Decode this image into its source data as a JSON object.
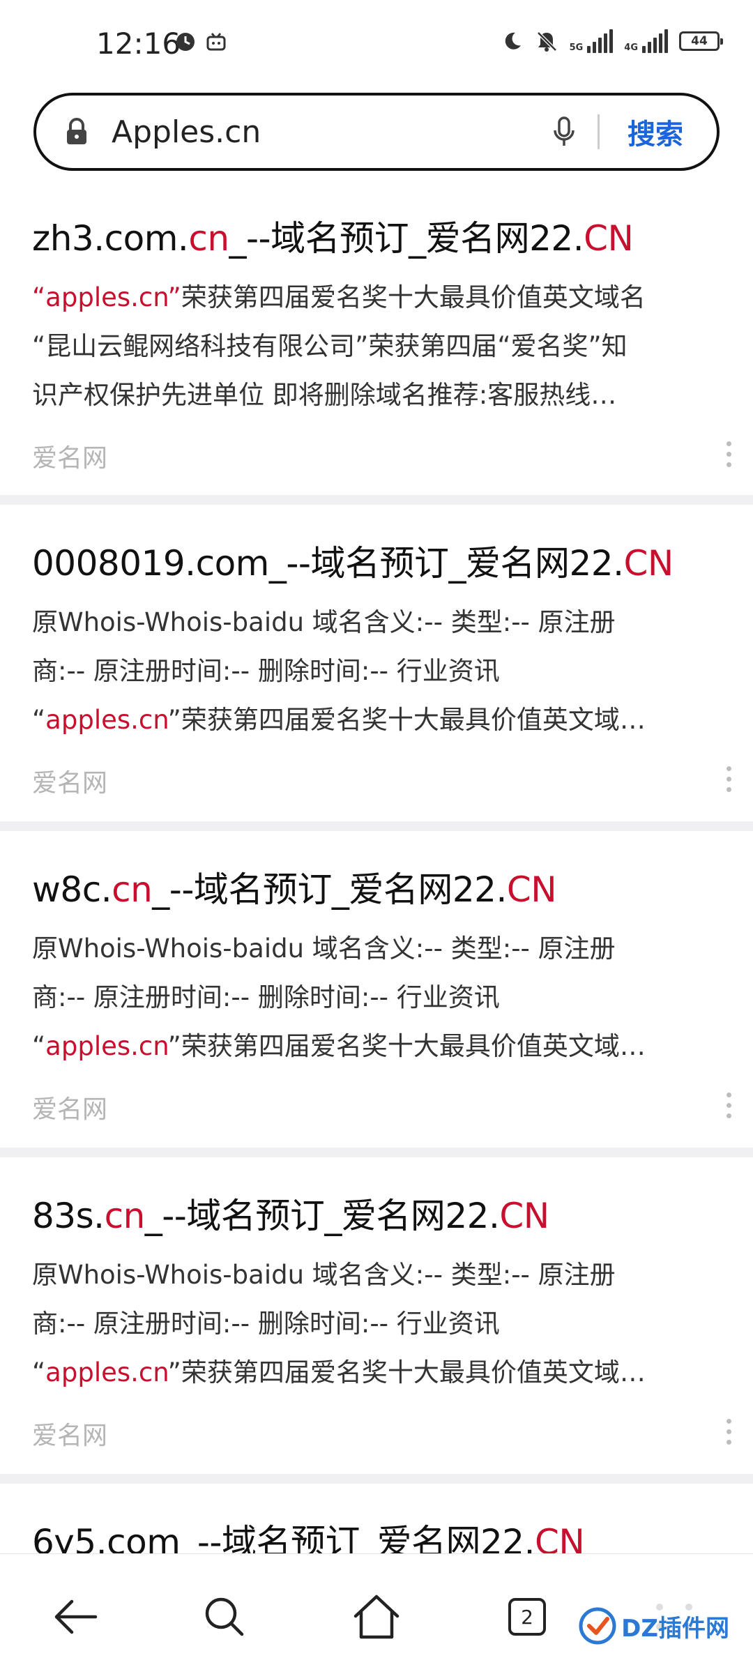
{
  "status_bar": {
    "time": "12:16",
    "sig1_label": "5G",
    "sig2_label": "4G",
    "battery": "44"
  },
  "search": {
    "query": "Apples.cn",
    "button_label": "搜索"
  },
  "results": [
    {
      "title_a": "zh3.com.",
      "title_b": "cn",
      "title_c": "_--域名预订_爱名网22.",
      "title_d": "CN",
      "line1_hl": "“apples.cn”",
      "line1_rest": "荣获第四届爱名奖十大最具价值英文域名",
      "line2": "“昆山云鲲网络科技有限公司”荣获第四届“爱名奖”知",
      "line3": "识产权保护先进单位 即将删除域名推荐:客服热线…",
      "source": "爱名网"
    },
    {
      "title_a": "0008019.com_--域名预订_爱名网22.",
      "title_d": "CN",
      "line1": "原Whois-Whois-baidu 域名含义:-- 类型:-- 原注册",
      "line2": "商:-- 原注册时间:-- 删除时间:-- 行业资讯",
      "line3_pre": "“",
      "line3_hl": "apples.cn",
      "line3_rest": "”荣获第四届爱名奖十大最具价值英文域…",
      "source": "爱名网"
    },
    {
      "title_a": "w8c.",
      "title_b": "cn",
      "title_c": "_--域名预订_爱名网22.",
      "title_d": "CN",
      "line1": "原Whois-Whois-baidu 域名含义:-- 类型:-- 原注册",
      "line2": "商:-- 原注册时间:-- 删除时间:-- 行业资讯",
      "line3_pre": "“",
      "line3_hl": "apples.cn",
      "line3_rest": "”荣获第四届爱名奖十大最具价值英文域…",
      "source": "爱名网"
    },
    {
      "title_a": "83s.",
      "title_b": "cn",
      "title_c": "_--域名预订_爱名网22.",
      "title_d": "CN",
      "line1": "原Whois-Whois-baidu 域名含义:-- 类型:-- 原注册",
      "line2": "商:-- 原注册时间:-- 删除时间:-- 行业资讯",
      "line3_pre": "“",
      "line3_hl": "apples.cn",
      "line3_rest": "”荣获第四届爱名奖十大最具价值英文域…",
      "source": "爱名网"
    },
    {
      "title_a": "6y5.com_--域名预订_爱名网22.",
      "title_d": "CN"
    }
  ],
  "bottom_nav": {
    "tab_count": "2"
  },
  "watermark": {
    "text": "DZ插件网"
  },
  "colors": {
    "highlight": "#c8102e",
    "link_blue": "#1a66d9",
    "source_gray": "#b5b5b5"
  }
}
